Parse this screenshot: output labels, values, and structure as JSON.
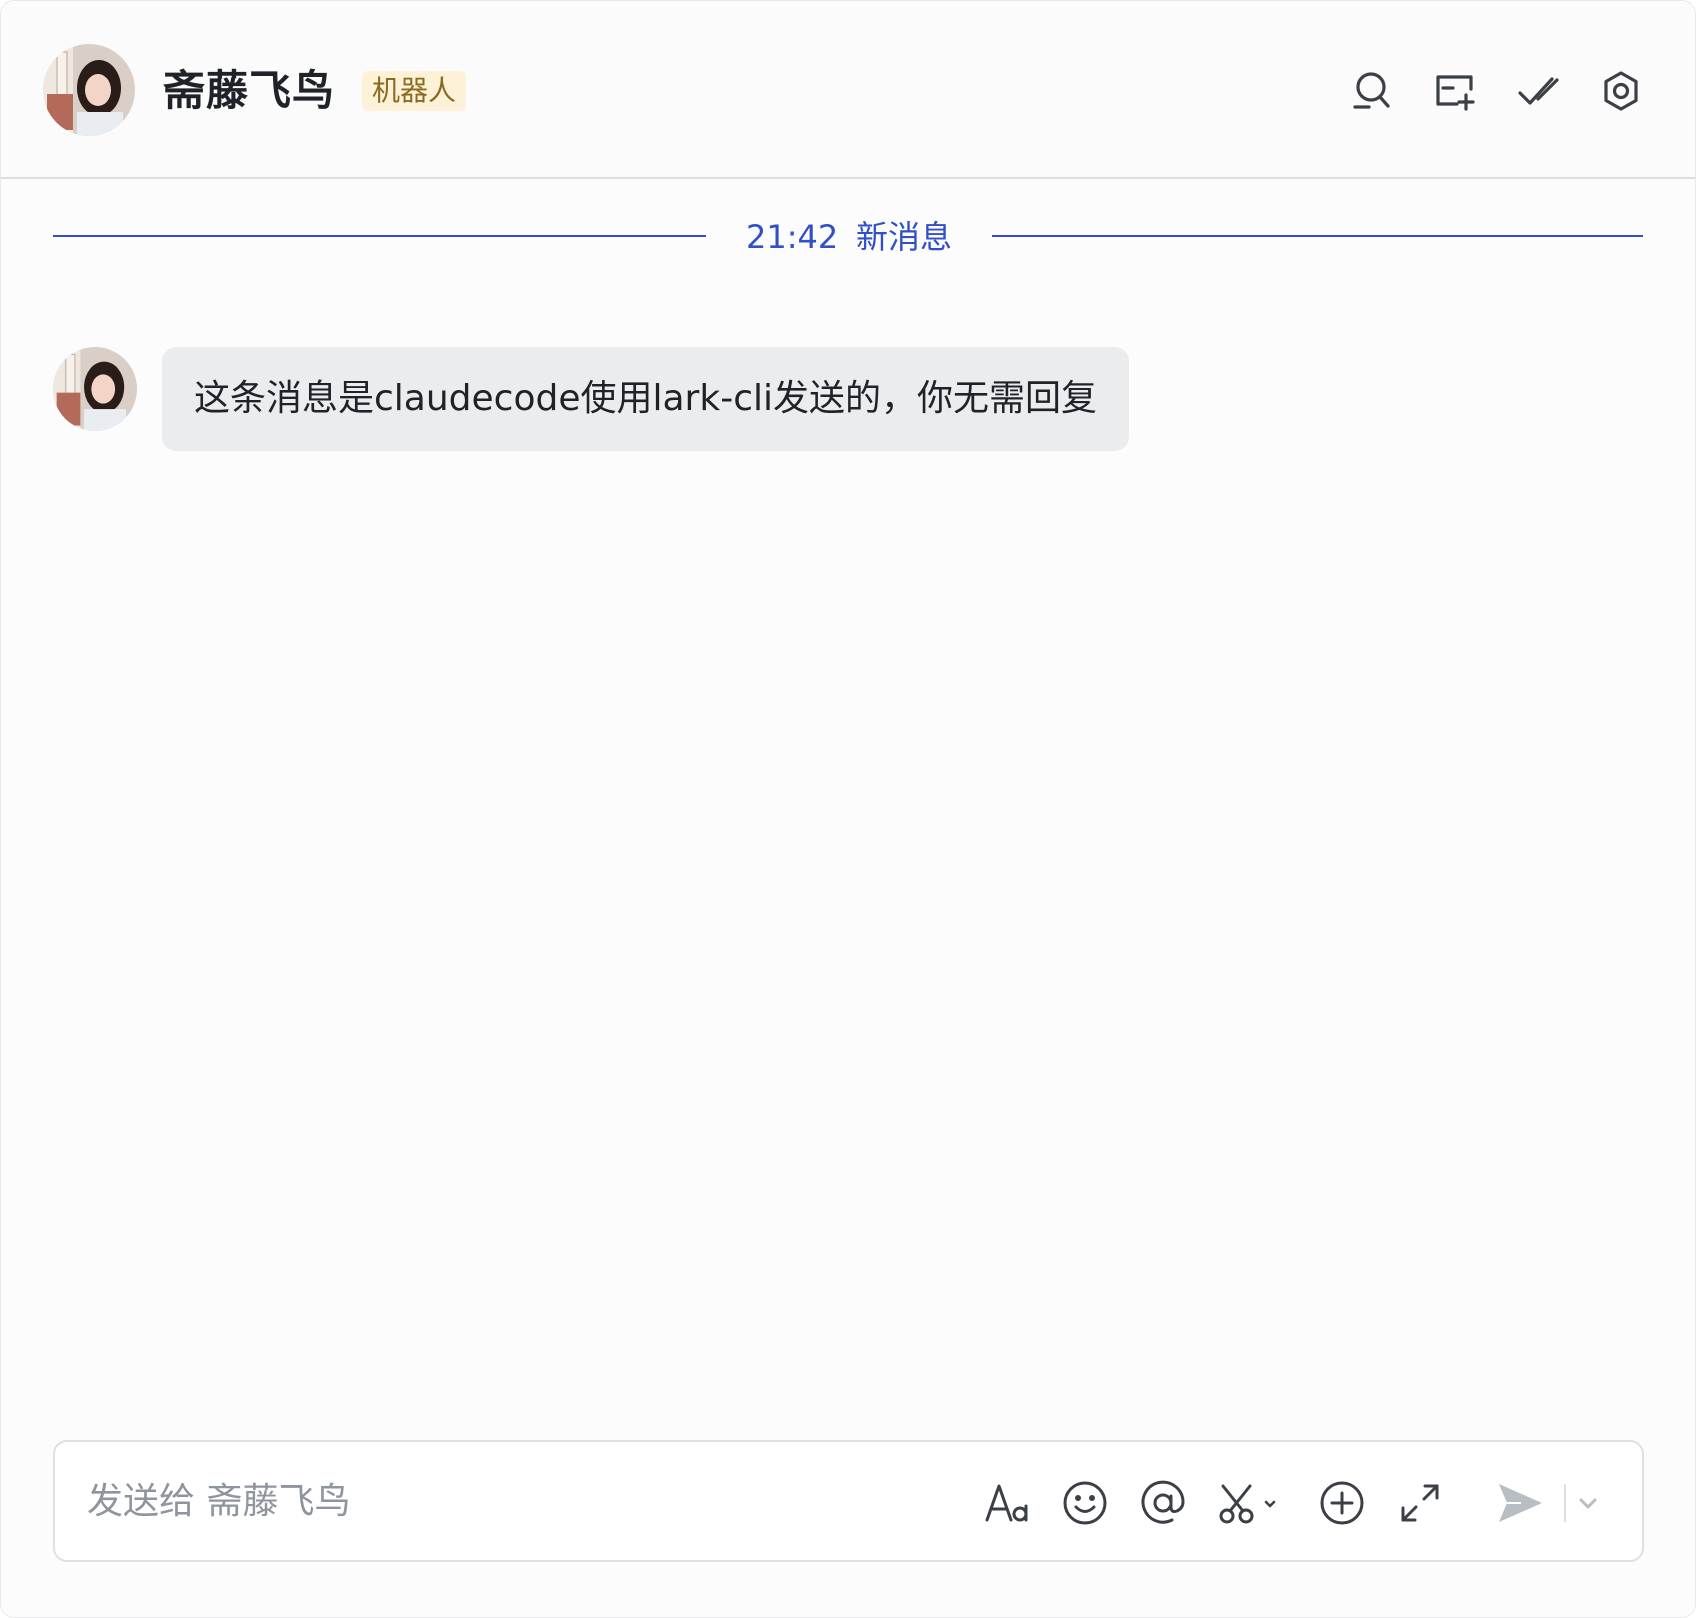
{
  "header": {
    "title": "斋藤飞鸟",
    "badge": "机器人",
    "icons": [
      "search-icon",
      "add-chat-icon",
      "mark-done-icon",
      "settings-icon"
    ]
  },
  "divider": {
    "time": "21:42",
    "label": "新消息"
  },
  "messages": [
    {
      "text": "这条消息是claudecode使用lark-cli发送的，你无需回复"
    }
  ],
  "composer": {
    "placeholder": "发送给 斋藤飞鸟",
    "icons": [
      "text-format-icon",
      "emoji-icon",
      "mention-icon",
      "screenshot-icon",
      "add-icon",
      "expand-icon",
      "send-icon",
      "send-options-chevron-icon"
    ]
  },
  "colors": {
    "accent": "#3150c8",
    "badge_bg": "#fdf1d8",
    "badge_text": "#8a6a1e",
    "bubble_bg": "#ebecee"
  }
}
